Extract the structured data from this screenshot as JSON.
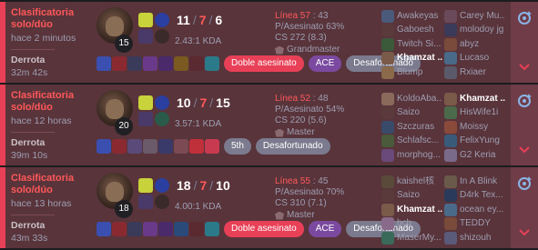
{
  "matches": [
    {
      "queue": "Clasificatoria solo/dúo",
      "ago": "hace 2 minutos",
      "result": "Derrota",
      "duration": "32m 42s",
      "level": "15",
      "kda": {
        "k": "11",
        "d": "7",
        "a": "6",
        "ratio": "2.43:1 KDA"
      },
      "lp_label": "Línea 57",
      "lp_time": " : 43",
      "kill_participation": "P/Asesinato 63%",
      "cs": "CS 272 (8.3)",
      "rank": "Grandmaster",
      "tags": [
        {
          "label": "Doble asesinato",
          "color": "red"
        },
        {
          "label": "ACE",
          "color": "purple"
        },
        {
          "label": "Desafortunado",
          "color": "gray"
        }
      ],
      "team1": [
        "Awakeyas",
        "Gaboesh",
        "Twitch Si...",
        "Khamzat ...",
        "Blump"
      ],
      "team2": [
        "Carey Mu...",
        "molodoy jg",
        "abyz",
        "Lucaso",
        "Rxiaer"
      ],
      "me_team": 1,
      "me_index": 3
    },
    {
      "queue": "Clasificatoria solo/dúo",
      "ago": "hace 12 horas",
      "result": "Derrota",
      "duration": "39m 10s",
      "level": "20",
      "kda": {
        "k": "10",
        "d": "7",
        "a": "15",
        "ratio": "3.57:1 KDA"
      },
      "lp_label": "Línea 52",
      "lp_time": " : 48",
      "kill_participation": "P/Asesinato 54%",
      "cs": "CS 220 (5.6)",
      "rank": "Master",
      "tags": [
        {
          "label": "5th",
          "color": "gray"
        },
        {
          "label": "Desafortunado",
          "color": "gray"
        }
      ],
      "team1": [
        "KoldoAba...",
        "Saizo",
        "Szczuras",
        "Schlafsc...",
        "morphog..."
      ],
      "team2": [
        "Khamzat ...",
        "HisWife1i",
        "Moissy",
        "FelixYung",
        "G2 Keria"
      ],
      "me_team": 2,
      "me_index": 0
    },
    {
      "queue": "Clasificatoria solo/dúo",
      "ago": "hace 13 horas",
      "result": "Derrota",
      "duration": "43m 33s",
      "level": "18",
      "kda": {
        "k": "18",
        "d": "7",
        "a": "10",
        "ratio": "4.00:1 KDA"
      },
      "lp_label": "Línea 55",
      "lp_time": " : 45",
      "kill_participation": "P/Asesinato 70%",
      "cs": "CS 310 (7.1)",
      "rank": "Master",
      "tags": [
        {
          "label": "Doble asesinato",
          "color": "red"
        },
        {
          "label": "ACE",
          "color": "purple"
        },
        {
          "label": "Desafortunado",
          "color": "gray"
        }
      ],
      "team1": [
        "kaishel核",
        "Saizo",
        "Khamzat ...",
        "bcb",
        "MaserMy..."
      ],
      "team2": [
        "In A Blink",
        "D4rk Tex...",
        "ocean ey...",
        "TEDDY",
        "shizouh"
      ],
      "me_team": 1,
      "me_index": 2
    }
  ],
  "colors": {
    "loss_bg": "#59343b",
    "loss_border": "#e84057",
    "accent_red": "#ff5859"
  }
}
